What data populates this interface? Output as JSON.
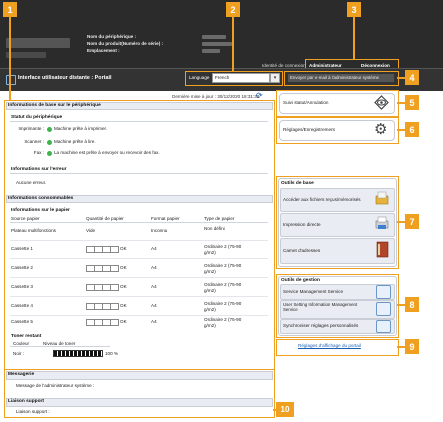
{
  "header": {
    "device_name_label": "Nom du périphérique :",
    "product_name_label": "Nom du produit(Numéro de série) :",
    "location_label": "Emplacement :",
    "login_id_label": "Identité de connexion",
    "user_role": "Administrateur",
    "logout_label": "Déconnexion",
    "app_title": "Interface utilisateur distante : Portail",
    "language_label": "Language",
    "language_value": "French",
    "email_admin_button": "Envoyer par e-mail à l'administrateur système"
  },
  "main": {
    "last_update": "Dernière mise à jour : 30/12/2020 18:31:32",
    "basic_info_title": "Informations de base sur le périphérique",
    "status_title": "Statut du périphérique",
    "status_rows": [
      {
        "label": "Imprimante :",
        "text": "Machine prête à imprimer."
      },
      {
        "label": "Scanner :",
        "text": "Machine prête à lire."
      },
      {
        "label": "Fax :",
        "text": "La machine est prête à envoyer ou recevoir des fax."
      }
    ],
    "error_title": "Informations sur l'erreur",
    "error_text": "Aucune erreur.",
    "consumables_title": "Informations consommables",
    "paper_info_title": "Informations sur le papier",
    "paper_columns": [
      "Source papier",
      "Quantité de papier",
      "Format papier",
      "Type de papier"
    ],
    "paper_rows": [
      {
        "source": "Plateau multifonctions",
        "qty": "Vide",
        "format": "Inconnu",
        "type": "Non défini",
        "boxes": false
      },
      {
        "source": "Cassette 1",
        "qty": "OK",
        "format": "A4",
        "type": "Ordinaire 2 (75-90 g/m2)",
        "boxes": true
      },
      {
        "source": "Cassette 2",
        "qty": "OK",
        "format": "A4",
        "type": "Ordinaire 2 (75-90 g/m2)",
        "boxes": true
      },
      {
        "source": "Cassette 3",
        "qty": "OK",
        "format": "A4",
        "type": "Ordinaire 2 (75-90 g/m2)",
        "boxes": true
      },
      {
        "source": "Cassette 4",
        "qty": "OK",
        "format": "A4",
        "type": "Ordinaire 2 (75-90 g/m2)",
        "boxes": true
      },
      {
        "source": "Cassette 5",
        "qty": "OK",
        "format": "A4",
        "type": "Ordinaire 2 (75-90 g/m2)",
        "boxes": true
      }
    ],
    "toner_title": "Toner restant",
    "toner_columns": [
      "Couleur",
      "Niveau de toner"
    ],
    "toner_row": {
      "color": "Noir :",
      "percent": "100 %",
      "level": 1.0
    },
    "messages_title": "Messagerie",
    "messages_text": "Message de l'administrateur système :",
    "support_title": "Liaison support",
    "support_text": "Liaison support :"
  },
  "side": {
    "status_button": "Suivi statut/Annulation",
    "settings_button": "Réglages/Enregistrement",
    "basic_tools_title": "Outils de base",
    "basic_tools": [
      "Accéder aux fichiers reçus/mémorisés",
      "Impression directe",
      "Carnet d'adresses"
    ],
    "mgmt_tools_title": "Outils de gestion",
    "mgmt_tools": [
      "Service Management Service",
      "User Setting Information Management Service",
      "Synchroniser réglages personnalisés"
    ],
    "portal_settings_link": "Réglages d'affichage du portail"
  },
  "callouts": [
    "1",
    "2",
    "3",
    "4",
    "5",
    "6",
    "7",
    "8",
    "9",
    "10"
  ],
  "colors": {
    "callout": "#f0a020",
    "header": "#2b2b2b",
    "panel": "#e9ecf2",
    "ok_green": "#3cb44b"
  }
}
